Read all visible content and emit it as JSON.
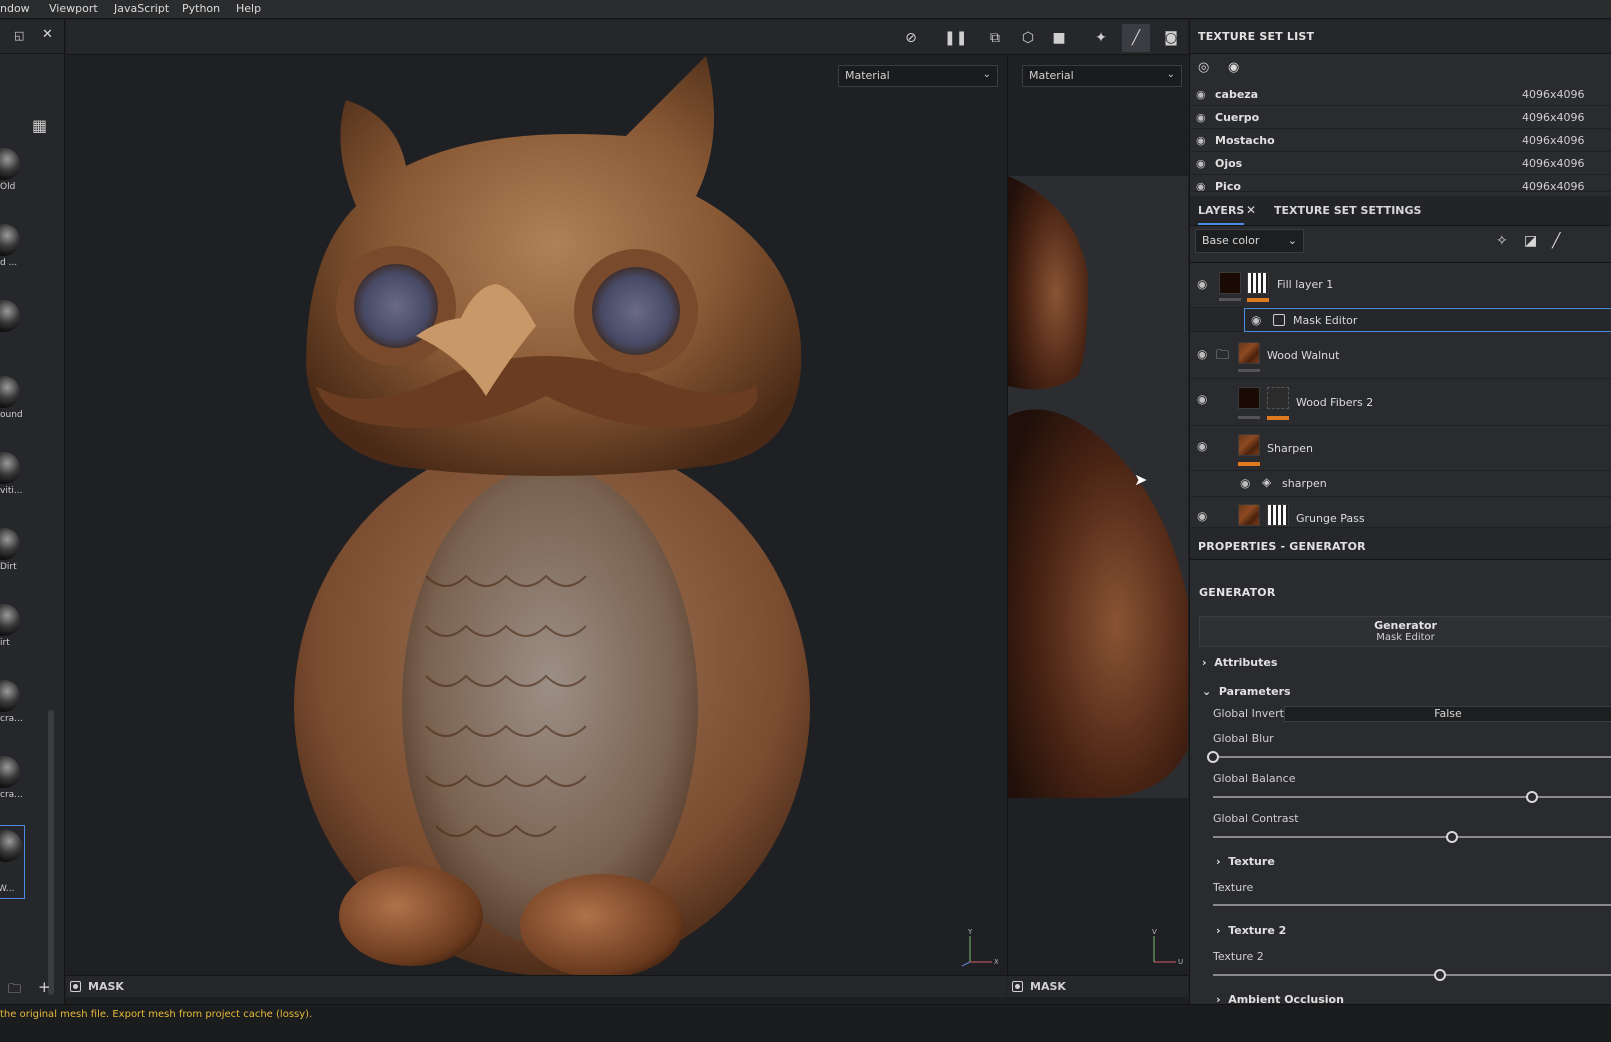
{
  "menu": [
    "ndow",
    "Viewport",
    "JavaScript",
    "Python",
    "Help"
  ],
  "shelf": {
    "items": [
      {
        "label": "Old"
      },
      {
        "label": "d ..."
      },
      {
        "label": ""
      },
      {
        "label": "ound"
      },
      {
        "label": "viti..."
      },
      {
        "label": "Dirt"
      },
      {
        "label": "irt"
      },
      {
        "label": "cra..."
      },
      {
        "label": "cra..."
      },
      {
        "label": "W..."
      }
    ]
  },
  "viewport": {
    "material_left": "Material",
    "material_right": "Material",
    "mask_left": "MASK",
    "mask_right": "MASK",
    "axis_y": "Y",
    "axis_x": "X",
    "axis_v": "V",
    "axis_u": "U"
  },
  "status": {
    "message": "the original mesh file. Export mesh from project cache (lossy)."
  },
  "texture_set_list": {
    "title": "TEXTURE SET LIST",
    "rows": [
      {
        "name": "cabeza",
        "res": "4096x4096"
      },
      {
        "name": "Cuerpo",
        "res": "4096x4096"
      },
      {
        "name": "Mostacho",
        "res": "4096x4096"
      },
      {
        "name": "Ojos",
        "res": "4096x4096"
      },
      {
        "name": "Pico",
        "res": "4096x4096"
      }
    ]
  },
  "layers": {
    "tab_layers": "LAYERS",
    "tab_settings": "TEXTURE SET SETTINGS",
    "channel": "Base color",
    "items": {
      "fill": "Fill layer 1",
      "mask_editor": "Mask Editor",
      "walnut": "Wood Walnut",
      "fibers": "Wood Fibers 2",
      "sharpen": "Sharpen",
      "sharpen_fx": "sharpen",
      "grunge": "Grunge Pass"
    }
  },
  "properties": {
    "title": "PROPERTIES - GENERATOR",
    "section": "GENERATOR",
    "gen_name": "Generator",
    "gen_sub": "Mask Editor",
    "attributes": "Attributes",
    "parameters": "Parameters",
    "global_invert_label": "Global Invert",
    "global_invert_value": "False",
    "global_blur": "Global Blur",
    "global_balance": "Global Balance",
    "global_contrast": "Global Contrast",
    "texture_section": "Texture",
    "texture_label": "Texture",
    "texture2_section": "Texture 2",
    "texture2_label": "Texture 2",
    "ambient_occlusion": "Ambient Occlusion",
    "sliders": {
      "blur": 0.0,
      "balance": 0.8,
      "contrast": 0.6,
      "texture2": 0.57
    }
  },
  "colors": {
    "accent": "#4a8de0",
    "orange": "#e07a1f",
    "status": "#e5b93a"
  }
}
